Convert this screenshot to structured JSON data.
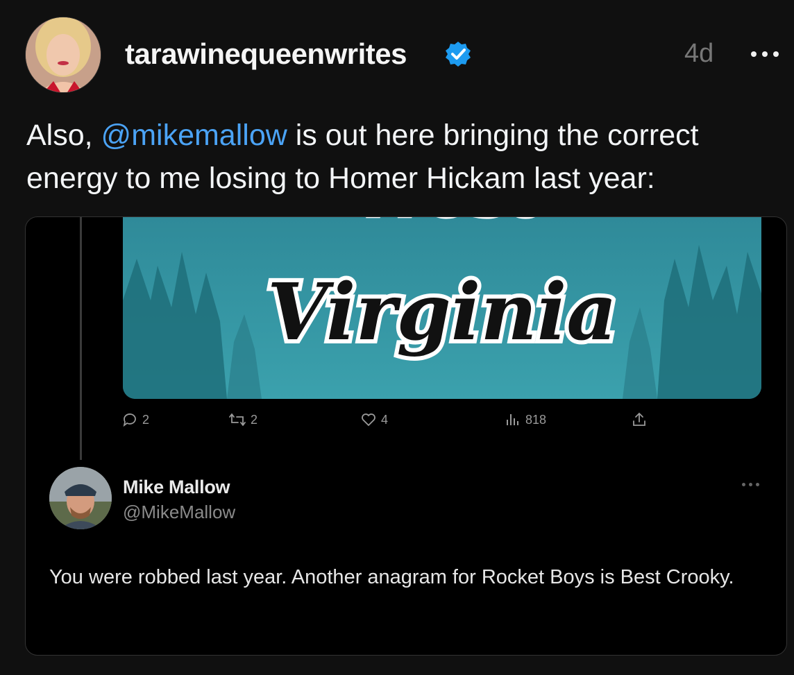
{
  "post": {
    "username": "tarawinequeenwrites",
    "timestamp": "4d",
    "text_before": "Also, ",
    "mention": "@mikemallow",
    "text_after": " is out here bringing the correct energy to me losing to Homer Hickam last year:"
  },
  "quoted": {
    "banner_text": "Virginia",
    "banner_top_partial": "West",
    "stats": {
      "replies": "2",
      "reposts": "2",
      "likes": "4",
      "views": "818"
    },
    "reply": {
      "name": "Mike Mallow",
      "handle": "@MikeMallow",
      "text": "You were robbed last year. Another anagram for Rocket Boys is Best Crooky."
    }
  },
  "colors": {
    "accent": "#4ba3f5",
    "background": "#101010",
    "card": "#000000",
    "banner": "#3a9aa8"
  },
  "icons": [
    "verified-badge-icon",
    "more-icon",
    "reply-icon",
    "repost-icon",
    "like-icon",
    "views-icon",
    "share-icon"
  ]
}
